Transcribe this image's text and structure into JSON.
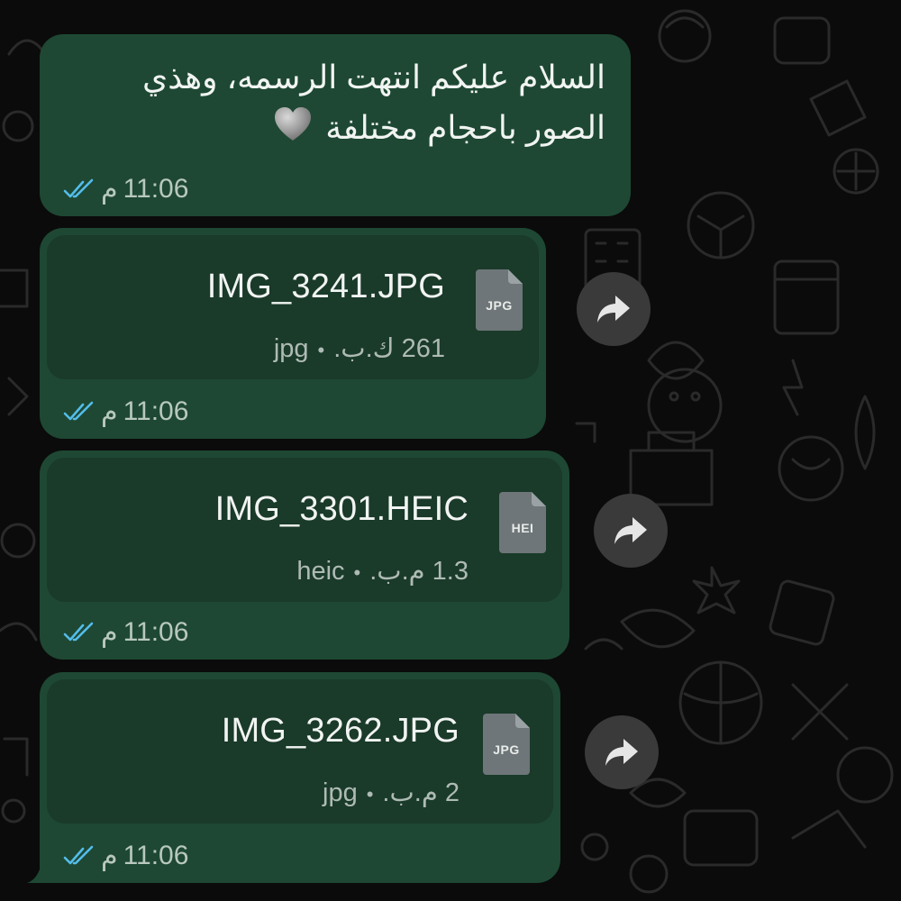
{
  "colors": {
    "background": "#0b0b0b",
    "bubble": "#1e4833",
    "file_card": "#1a3a2a",
    "read_ticks": "#53bdeb",
    "forward_button": "#3a3a3a"
  },
  "messages": [
    {
      "type": "text",
      "text_line1": "السلام عليكم انتهت الرسمه، وهذي",
      "text_line2": "الصور باحجام مختلفة",
      "emoji_icon": "grey-heart-icon",
      "time": "11:06",
      "ampm": "م",
      "status_icon": "double-check-read-icon"
    },
    {
      "type": "file",
      "file_name": "IMG_3241.JPG",
      "file_icon_label": "JPG",
      "file_size": "261 ك.ب.",
      "file_ext": "jpg",
      "separator": "•",
      "time": "11:06",
      "ampm": "م",
      "status_icon": "double-check-read-icon",
      "action_icon": "forward-icon"
    },
    {
      "type": "file",
      "file_name": "IMG_3301.HEIC",
      "file_icon_label": "HEI",
      "file_size": "1.3 م.ب.",
      "file_ext": "heic",
      "separator": "•",
      "time": "11:06",
      "ampm": "م",
      "status_icon": "double-check-read-icon",
      "action_icon": "forward-icon"
    },
    {
      "type": "file",
      "file_name": "IMG_3262.JPG",
      "file_icon_label": "JPG",
      "file_size": "2 م.ب.",
      "file_ext": "jpg",
      "separator": "•",
      "time": "11:06",
      "ampm": "م",
      "status_icon": "double-check-read-icon",
      "action_icon": "forward-icon"
    }
  ]
}
